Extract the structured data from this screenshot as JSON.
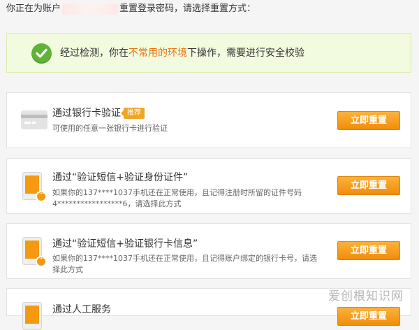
{
  "header": {
    "prefix": "你正在为账户",
    "suffix": "重置登录密码，请选择重置方式："
  },
  "notice": {
    "before": "经过检测，你在",
    "highlight": "不常用的环境",
    "after": "下操作，需要进行安全校验",
    "highlight_color": "#e8730e",
    "icon": "check-circle-icon"
  },
  "methods": [
    {
      "title": "通过银行卡验证",
      "badge": "推荐",
      "desc": "可使用的任意一张银行卡进行验证",
      "button": "立即重置",
      "icon": "bank-card-icon"
    },
    {
      "title": "通过“验证短信+验证身份证件”",
      "desc": "如果你的137****1037手机还在正常使用，且记得注册时所留的证件号码4*****************6，请选择此方式",
      "button": "立即重置",
      "icon": "phone-sms-icon"
    },
    {
      "title": "通过“验证短信+验证银行卡信息”",
      "desc": "如果你的137****1037手机还在正常使用，且记得账户绑定的银行卡号，请选择此方式",
      "button": "立即重置",
      "icon": "phone-sms-icon"
    },
    {
      "title": "通过人工服务",
      "button": "立即重置",
      "icon": "phone-sms-icon"
    }
  ],
  "watermark": "爱创根知识网",
  "colors": {
    "accent": "#f18c0b",
    "success": "#5fb336",
    "notice_bg": "#f2fadf"
  }
}
